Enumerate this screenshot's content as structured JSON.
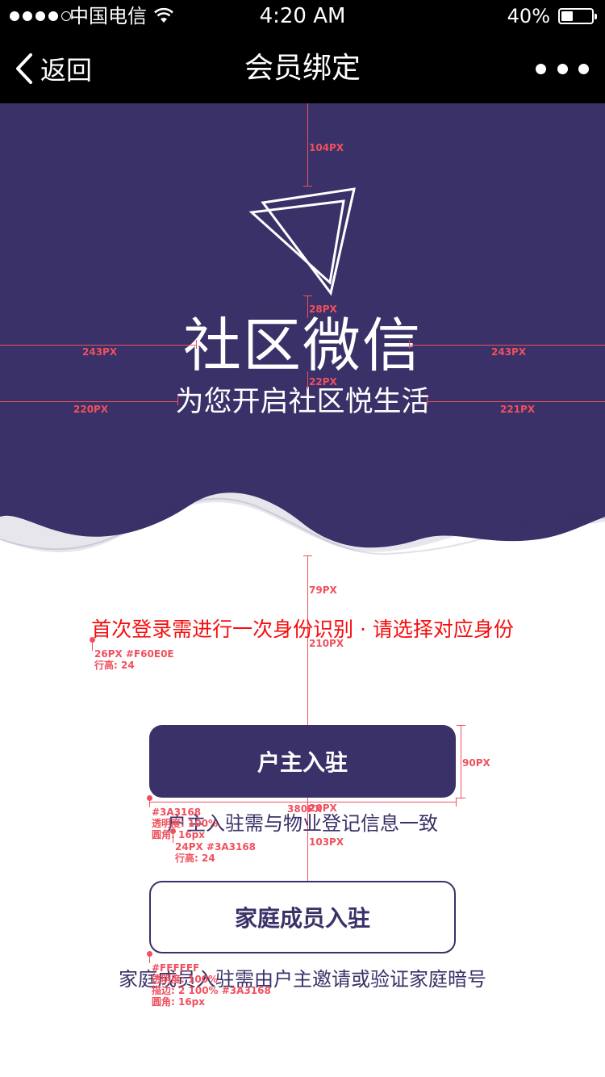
{
  "status_bar": {
    "carrier": "中国电信",
    "time": "4:20 AM",
    "battery": "40%",
    "battery_level": 0.4,
    "signal_bars": 4
  },
  "nav": {
    "back_label": "返回",
    "title": "会员绑定"
  },
  "hero": {
    "title": "社区微信",
    "subtitle": "为您开启社区悦生活",
    "background_color": "#3A3168"
  },
  "notice": "首次登录需进行一次身份识别 · 请选择对应身份",
  "buttons": {
    "owner": {
      "label": "户主入驻",
      "hint": "户主入驻需与物业登记信息一致"
    },
    "family": {
      "label": "家庭成员入驻",
      "hint": "家庭成员入驻需由户主邀请或验证家庭暗号"
    }
  },
  "annotations": {
    "top_gap": "104PX",
    "logo_gap": "28PX",
    "title_left": "243PX",
    "title_right": "243PX",
    "sub_gap": "22PX",
    "sub_left": "220PX",
    "sub_right": "221PX",
    "notice_gap": "79PX",
    "notice_spec": [
      "26PX #F60E0E",
      "行高: 24"
    ],
    "button_gap": "210PX",
    "button_height": "90PX",
    "button_width": "380PX",
    "hint_gap": "20PX",
    "between_gap": "103PX",
    "owner_spec": [
      "#3A3168",
      "透明度: 100%",
      "圆角: 16px"
    ],
    "hint_spec": [
      "24PX #3A3168",
      "行高: 24"
    ],
    "family_spec": [
      "#FFFFFF",
      "透明度: 100%",
      "描边: 2 100% #3A3168",
      "圆角: 16px"
    ]
  },
  "colors": {
    "brand": "#3A3168",
    "notice": "#F60E0E",
    "annotation": "#F0505E"
  }
}
